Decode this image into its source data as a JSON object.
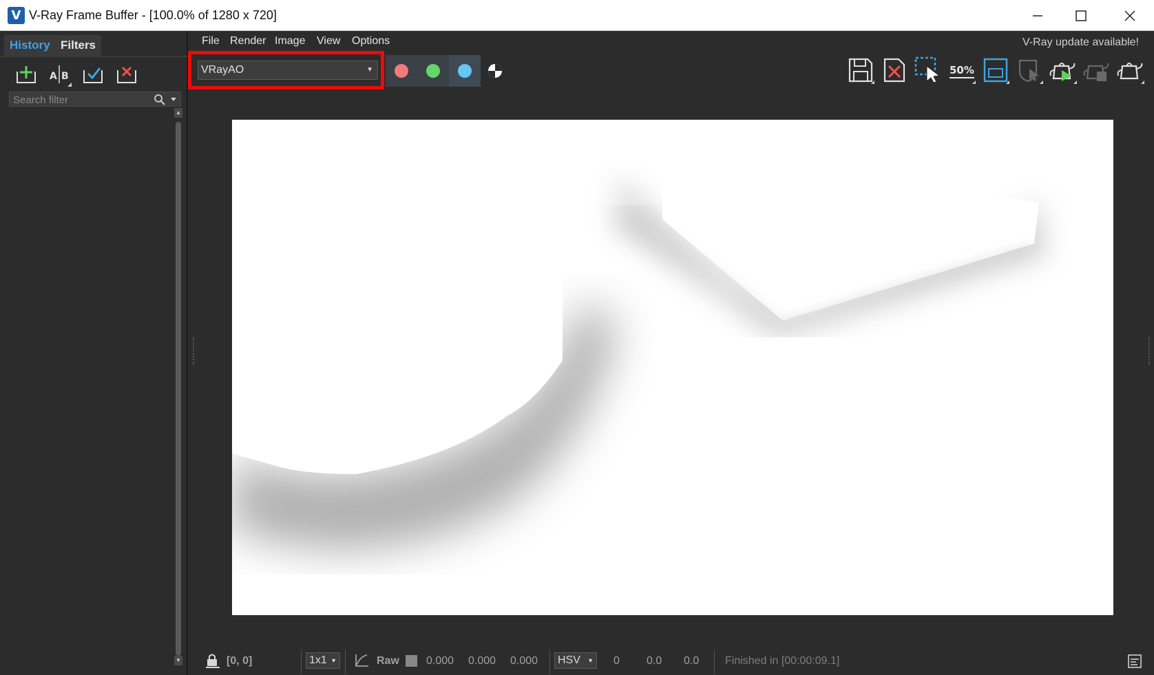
{
  "window": {
    "title": "V-Ray Frame Buffer - [100.0% of 1280 x 720]",
    "logo_letter": "V"
  },
  "sidebar": {
    "tabs": [
      {
        "label": "History"
      },
      {
        "label": "Filters"
      }
    ],
    "search": {
      "placeholder": "Search filter"
    },
    "ab_label_a": "A",
    "ab_label_b": "B"
  },
  "menu": {
    "items": [
      "File",
      "Render",
      "Image",
      "View",
      "Options"
    ],
    "update_notice": "V-Ray update available!"
  },
  "toolbar": {
    "channel_value": "VRayAO",
    "zoom_badge": "50%",
    "channel_colors": {
      "red": "#f27a7a",
      "green": "#66d66a",
      "blue": "#66c6f5"
    }
  },
  "status": {
    "coords": "[0, 0]",
    "sample_size": "1x1",
    "raw_label": "Raw",
    "rgb": [
      "0.000",
      "0.000",
      "0.000"
    ],
    "color_mode": "HSV",
    "hsv": [
      "0",
      "0.0",
      "0.0"
    ],
    "finished": "Finished in [00:00:09.1]"
  },
  "colors": {
    "accent": "#3ea3e4",
    "highlight": "#ee0a0a"
  }
}
